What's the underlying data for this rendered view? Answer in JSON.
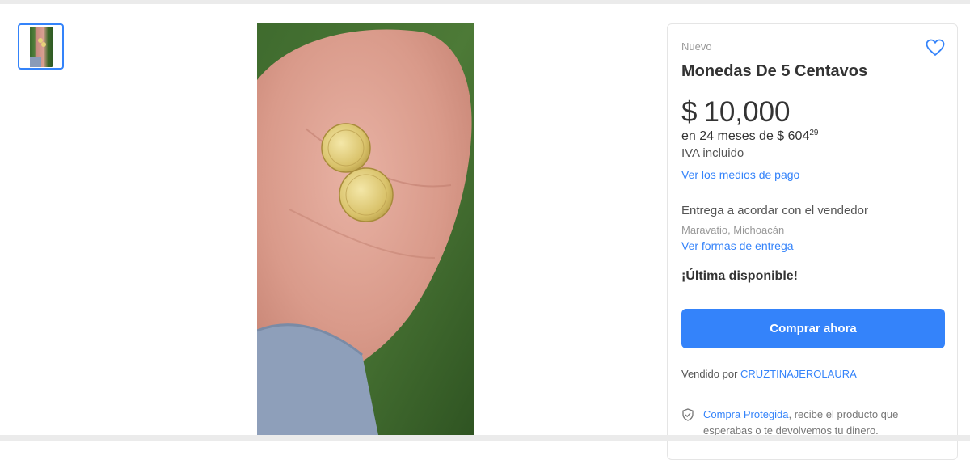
{
  "gallery": {
    "thumbnail_alt": "Monedas en la palma de la mano"
  },
  "product": {
    "condition": "Nuevo",
    "title": "Monedas De 5 Centavos",
    "price_currency": "$",
    "price_amount": "10,000",
    "installments_text": "en 24 meses de $ 604",
    "installments_cents": "29",
    "tax_note": "IVA incluido",
    "payment_link": "Ver los medios de pago"
  },
  "shipping": {
    "title": "Entrega a acordar con el vendedor",
    "location": "Maravatio, Michoacán",
    "link": "Ver formas de entrega"
  },
  "stock": {
    "label": "¡Última disponible!"
  },
  "actions": {
    "buy_now": "Comprar ahora"
  },
  "seller": {
    "prefix": "Vendido por",
    "name": "CRUZTINAJEROLAURA"
  },
  "protection": {
    "link": "Compra Protegida",
    "text": ", recibe el producto que esperabas o te devolvemos tu dinero."
  },
  "colors": {
    "accent": "#3483fa",
    "text": "#333333",
    "muted": "#999999"
  }
}
